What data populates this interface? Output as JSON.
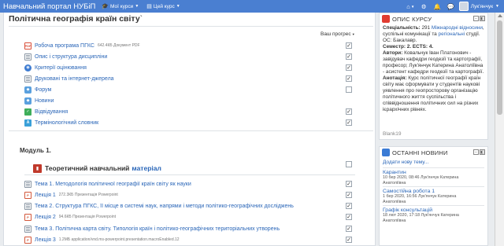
{
  "navbar": {
    "brand": "Навчальний портал НУБіП",
    "my_courses": "Мої курси",
    "this_course": "Цей курс",
    "user_name": "Лук'янчук",
    "icons": [
      "home-icon",
      "gear-icon",
      "bell-icon",
      "chat-icon"
    ]
  },
  "course": {
    "title": "Політична географія країн світу",
    "title_mark": "`",
    "progress_label": "Ваш прогрес"
  },
  "activities_top": [
    {
      "icon": "pdf",
      "label": "Робоча програма ПГКС",
      "meta": "642.4КБ Документ PDF",
      "done": true
    },
    {
      "icon": "page",
      "label": "Опис і структура дисципліни",
      "meta": "",
      "done": true
    },
    {
      "icon": "url",
      "label": "Критерії оцінювання",
      "meta": "",
      "done": true
    },
    {
      "icon": "page",
      "label": "Друковані та інтернет-джерела",
      "meta": "",
      "done": true
    },
    {
      "icon": "forum",
      "label": "Форум",
      "meta": "",
      "done": false
    },
    {
      "icon": "news",
      "label": "Новини",
      "meta": "",
      "done": null
    },
    {
      "icon": "feedback",
      "label": "Відвідування",
      "meta": "",
      "done": true
    },
    {
      "icon": "glossary",
      "label": "Термінологічний словник",
      "meta": "",
      "done": true
    }
  ],
  "section": {
    "title": "Модуль 1.",
    "subheading_prefix": "Теоретичний навчальний",
    "subheading_link": "матеріал"
  },
  "activities_module": [
    {
      "icon": "page",
      "label": "Тема 1. Методологія політичної географії країн світу як науки",
      "meta": "",
      "done": true
    },
    {
      "icon": "ppt",
      "label": "Лекція 1",
      "meta": "272.3КБ Презентація Powerpoint",
      "done": true
    },
    {
      "icon": "page",
      "label": "Тема 2. Структура ПГКС, її місце в системі наук, напрями і методи політико-географічних досліджень",
      "meta": "",
      "done": true
    },
    {
      "icon": "ppt",
      "label": "Лекція 2",
      "meta": "94.6КБ Презентація Powerpoint",
      "done": true
    },
    {
      "icon": "page",
      "label": "Тема 3. Політична карта світу. Типологія країн і політико-географічних територіальних утворень",
      "meta": "",
      "done": true
    },
    {
      "icon": "ppt",
      "label": "Лекція 3",
      "meta": "1.2МБ application/vnd.ms-powerpoint.presentation.macroEnabled.12",
      "done": true
    }
  ],
  "opys": {
    "title": "ОПИС КУРСУ",
    "spec_label": "Спеціальність:",
    "spec_pre": "291",
    "spec_link1": "Міжнародні відносини",
    "spec_mid": ", суспільні комунікації та",
    "spec_link2": "регіональні",
    "spec_post": "студії. ОС: Бакалавр.",
    "semester": "Семестр: 2. ECTS: 4.",
    "authors_label": "Автори:",
    "authors_text": "Ковальчук Іван Платонович - завідувач кафедри геодезії та картографії, професор; Лук'янчук Катерина Анатоліївна - асистент кафедри геодезії та картографії.",
    "annot_label": "Анотація:",
    "annot_text": "Курс політичної географії країн світу має сформувати у студентів наукові уявлення про геопросторову організацію політичного життя суспільства і співвідношення політичних сил на різних ієрархічних рівнях.",
    "footer": "Blank19"
  },
  "news": {
    "title": "ОСТАННІ НОВИНИ",
    "add_link": "Додати нову тему...",
    "items": [
      {
        "title": "Карантин",
        "meta1": "10 бер 2020, 08:46 Лук'янчук Катерина",
        "meta2": "Анатоліївна"
      },
      {
        "title": "Самостійна робота 1",
        "meta1": "1 бер 2020, 16:56 Лук'янчук Катерина",
        "meta2": "Анатоліївна"
      },
      {
        "title": "Графік консультацій",
        "meta1": "18 лют 2020, 17:18 Лук'янчук Катерина",
        "meta2": "Анатоліївна"
      }
    ]
  }
}
